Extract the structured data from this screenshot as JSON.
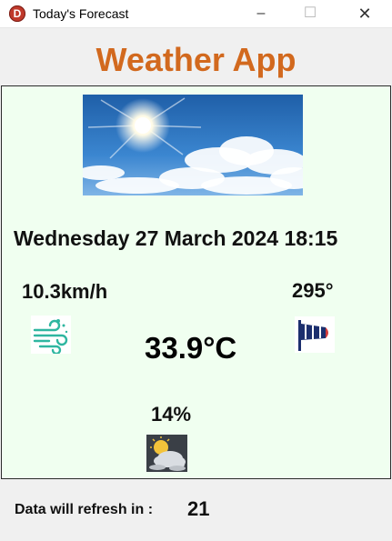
{
  "window": {
    "title": "Today's Forecast",
    "app_icon_letter": "D",
    "minimize_glyph": "–",
    "maximize_glyph": "☐",
    "close_glyph": "✕"
  },
  "header": {
    "app_title": "Weather App",
    "accent_color": "#d2691e"
  },
  "weather": {
    "datetime": "Wednesday 27 March 2024 18:15",
    "wind_speed": "10.3km/h",
    "wind_direction": "295°",
    "temperature": "33.9°C",
    "humidity": "14%",
    "icons": {
      "hero": "sunny-sky-image",
      "wind_speed": "wind-icon",
      "wind_direction": "windsock-icon",
      "humidity": "sun-behind-clouds-icon"
    }
  },
  "footer": {
    "refresh_label": "Data will refresh in :",
    "refresh_seconds": "21"
  },
  "colors": {
    "panel_background": "#f0fff0",
    "window_background": "#f0f0f0"
  }
}
